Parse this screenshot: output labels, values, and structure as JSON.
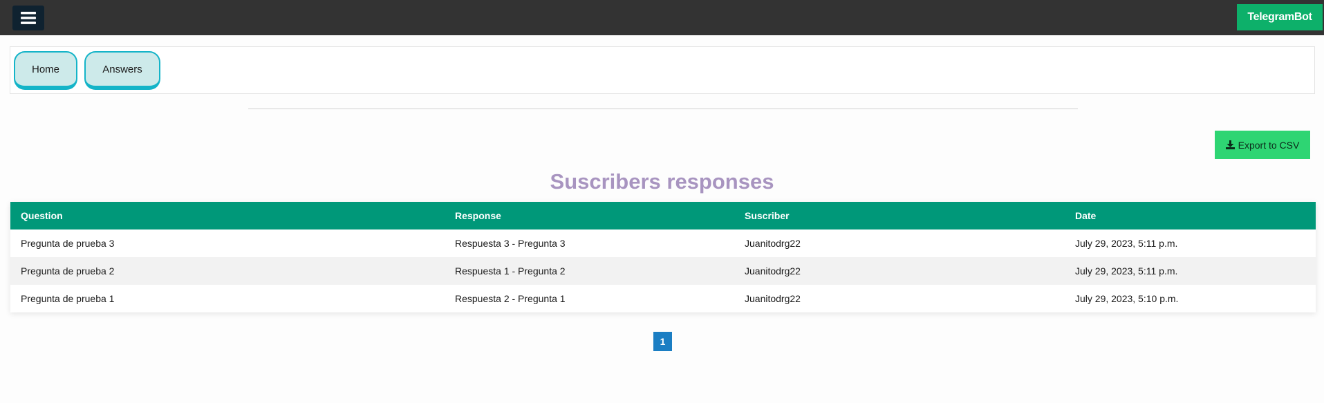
{
  "header": {
    "menu_icon": "hamburger-menu-icon",
    "brand_label": "TelegramBot",
    "brand_color": "#0db06a",
    "bar_color": "#333333"
  },
  "nav": {
    "items": [
      {
        "label": "Home"
      },
      {
        "label": "Answers"
      }
    ],
    "accent": "#14b4c8"
  },
  "actions": {
    "export_label": "Export to CSV",
    "export_icon": "download-icon",
    "export_color": "#2ed573"
  },
  "main": {
    "title": "Suscribers responses",
    "title_color": "#a894c0"
  },
  "table": {
    "header_color": "#009879",
    "columns": [
      "Question",
      "Response",
      "Suscriber",
      "Date"
    ],
    "rows": [
      {
        "question": "Pregunta de prueba 3",
        "response": "Respuesta 3 - Pregunta 3",
        "suscriber": "Juanitodrg22",
        "date": "July 29, 2023, 5:11 p.m."
      },
      {
        "question": "Pregunta de prueba 2",
        "response": "Respuesta 1 - Pregunta 2",
        "suscriber": "Juanitodrg22",
        "date": "July 29, 2023, 5:11 p.m."
      },
      {
        "question": "Pregunta de prueba 1",
        "response": "Respuesta 2 - Pregunta 1",
        "suscriber": "Juanitodrg22",
        "date": "July 29, 2023, 5:10 p.m."
      }
    ]
  },
  "pagination": {
    "current_page": "1",
    "color": "#1b7ec3"
  }
}
